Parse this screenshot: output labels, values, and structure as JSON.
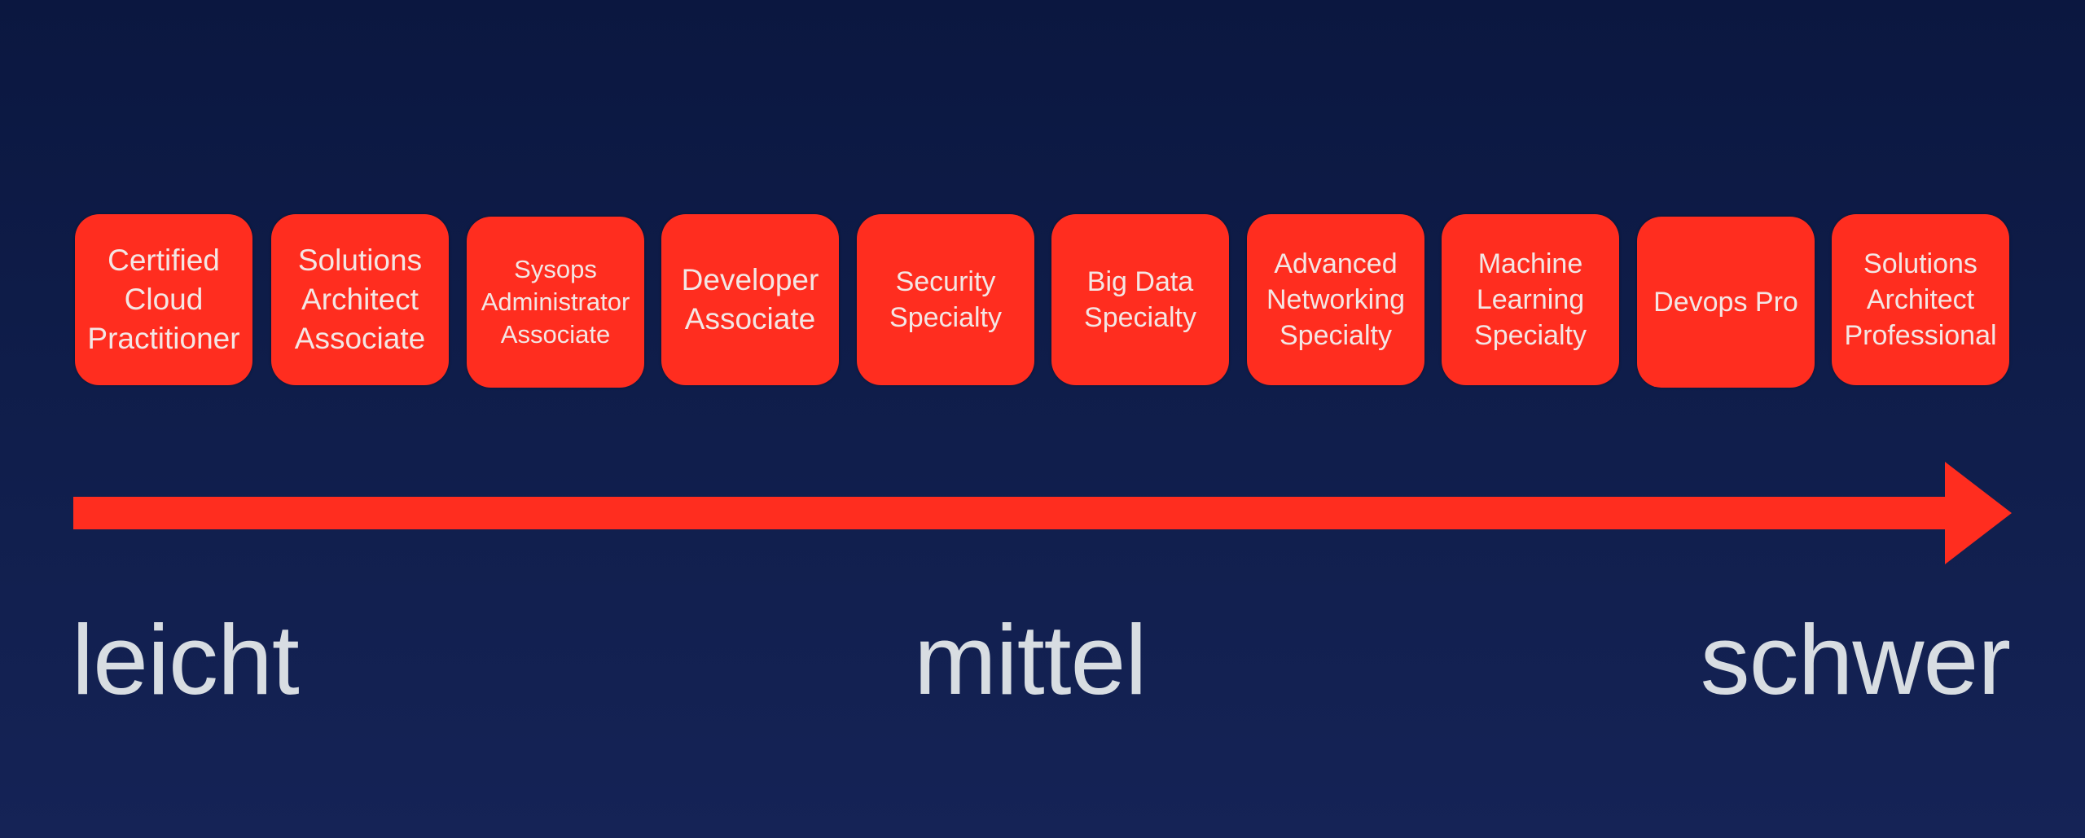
{
  "colors": {
    "background_top": "#0b1740",
    "background_bottom": "#152356",
    "card": "#ff2d1f",
    "card_text": "#f4e6e4",
    "arrow": "#ff2d1f",
    "scale_text": "#d8dde2"
  },
  "certifications": [
    {
      "label": "Certified\nCloud\nPractitioner"
    },
    {
      "label": "Solutions\nArchitect\nAssociate"
    },
    {
      "label": "Sysops\nAdministrator\nAssociate"
    },
    {
      "label": "Developer\nAssociate"
    },
    {
      "label": "Security\nSpecialty"
    },
    {
      "label": "Big Data\nSpecialty"
    },
    {
      "label": "Advanced\nNetworking\nSpecialty"
    },
    {
      "label": "Machine\nLearning\nSpecialty"
    },
    {
      "label": "Devops Pro"
    },
    {
      "label": "Solutions\nArchitect\nProfessional"
    }
  ],
  "arrow": {
    "direction": "right",
    "meaning": "difficulty-increasing"
  },
  "scale": {
    "easy": "leicht",
    "medium": "mittel",
    "hard": "schwer"
  }
}
